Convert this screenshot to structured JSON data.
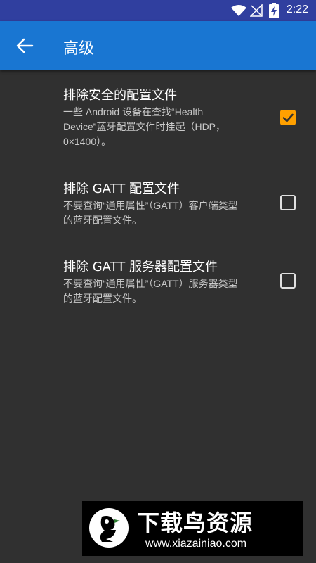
{
  "status": {
    "time": "2:22"
  },
  "appbar": {
    "title": "高级"
  },
  "settings": [
    {
      "title": "排除安全的配置文件",
      "summary": "一些 Android 设备在查找“Health Device”蓝牙配置文件时挂起（HDP，0×1400）。",
      "checked": true
    },
    {
      "title": "排除 GATT 配置文件",
      "summary": "不要查询“通用属性”（GATT）客户端类型的蓝牙配置文件。",
      "checked": false
    },
    {
      "title": "排除 GATT 服务器配置文件",
      "summary": "不要查询“通用属性”（GATT）服务器类型的蓝牙配置文件。",
      "checked": false
    }
  ],
  "watermark": {
    "brand": "下载鸟资源",
    "url": "www.xiazainiao.com"
  },
  "colors": {
    "statusbar": "#303f9f",
    "appbar": "#1976d2",
    "background": "#303030",
    "checkbox_checked": "#ffa000"
  }
}
